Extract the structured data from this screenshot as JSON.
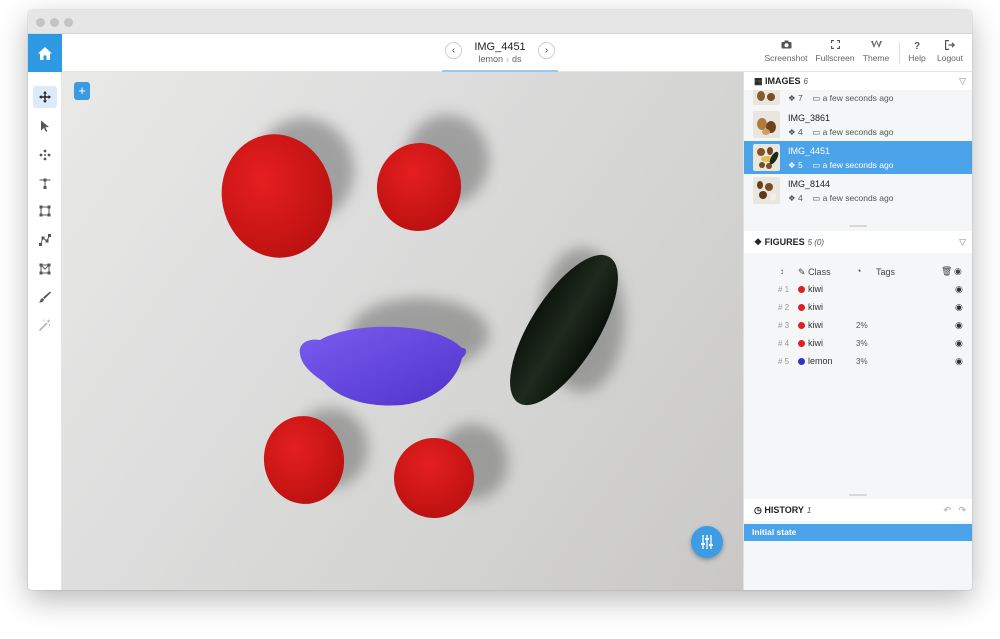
{
  "topbar": {
    "image_title": "IMG_4451",
    "breadcrumb": {
      "project": "lemon",
      "dataset": "ds"
    },
    "tools": [
      {
        "label": "Screenshot",
        "icon": "camera-icon"
      },
      {
        "label": "Fullscreen",
        "icon": "fullscreen-icon"
      },
      {
        "label": "Theme",
        "icon": "theme-icon"
      },
      {
        "label": "Help",
        "icon": "help-icon"
      },
      {
        "label": "Logout",
        "icon": "logout-icon"
      }
    ],
    "help_glyph": "?"
  },
  "canvas": {
    "add_button_label": "+"
  },
  "images": {
    "title": "IMAGES",
    "count": "6",
    "items": [
      {
        "name": "",
        "figures": "7",
        "time": "a few seconds ago",
        "selected": false
      },
      {
        "name": "IMG_3861",
        "figures": "4",
        "time": "a few seconds ago",
        "selected": false
      },
      {
        "name": "IMG_4451",
        "figures": "5",
        "time": "a few seconds ago",
        "selected": true
      },
      {
        "name": "IMG_8144",
        "figures": "4",
        "time": "a few seconds ago",
        "selected": false
      }
    ]
  },
  "figures": {
    "title": "FIGURES",
    "count": "5 (0)",
    "col_class": "Class",
    "col_tags": "Tags",
    "items": [
      {
        "index": "# 1",
        "class": "kiwi",
        "color": "#e02020",
        "area": ""
      },
      {
        "index": "# 2",
        "class": "kiwi",
        "color": "#e02020",
        "area": ""
      },
      {
        "index": "# 3",
        "class": "kiwi",
        "color": "#e02020",
        "area": "2%"
      },
      {
        "index": "# 4",
        "class": "kiwi",
        "color": "#e02020",
        "area": "3%"
      },
      {
        "index": "# 5",
        "class": "lemon",
        "color": "#2a35c8",
        "area": "3%"
      }
    ]
  },
  "history": {
    "title": "HISTORY",
    "count": "1",
    "items": [
      {
        "label": "Initial state"
      }
    ]
  },
  "colors": {
    "accent": "#2e9ae4",
    "selected_row": "#4ba3ea",
    "kiwi": "#e02020",
    "lemon": "#6a4de0"
  }
}
